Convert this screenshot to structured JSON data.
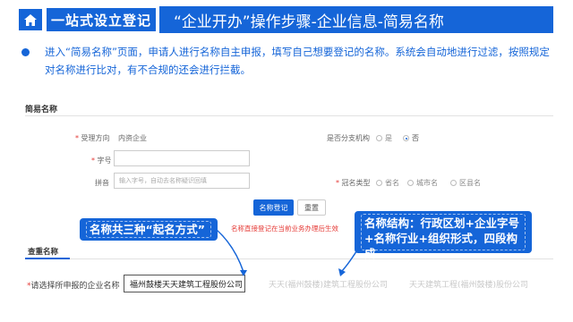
{
  "header": {
    "home_icon": "home-icon",
    "section": "一站式设立登记",
    "title": "“企业开办”操作步骤-企业信息-简易名称"
  },
  "intro": {
    "text": "进入“简易名称”页面，申请人进行名称自主申报，填写自己想要登记的名称。系统会自动地进行过滤，按照规定对名称进行比对，有不合规的还会进行拦截。"
  },
  "form": {
    "heading": "简易名称",
    "direction_label": "受理方向",
    "direction_value": "内资企业",
    "branch_label": "是否分支机构",
    "branch_options": [
      "是",
      "否"
    ],
    "branch_selected": "否",
    "trade_label": "字号",
    "pinyin_label": "拼音",
    "pinyin_placeholder": "输入字号，自动去名称疑识回填",
    "crown_label": "冠名类型",
    "crown_options": [
      "省名",
      "城市名",
      "区县名"
    ],
    "submit_label": "名称登记",
    "reset_label": "重置",
    "warning": "名称直接登记在当前业务办理后生效"
  },
  "results": {
    "tab": "查重名称",
    "choose_label": "请选择所申报的企业名称",
    "selected_name": "福州鼓楼天天建筑工程股份公司",
    "alt_names": [
      "天天(福州鼓楼)建筑工程股份公司",
      "天天建筑工程(福州鼓楼)股份公司"
    ]
  },
  "callouts": {
    "methods": "名称共三种“起名方式”",
    "structure": "名称结构：行政区划+企业字号+名称行业+组织形式，四段构成"
  },
  "colors": {
    "brand_blue": "#1565d8",
    "warning_red": "#e53935"
  }
}
